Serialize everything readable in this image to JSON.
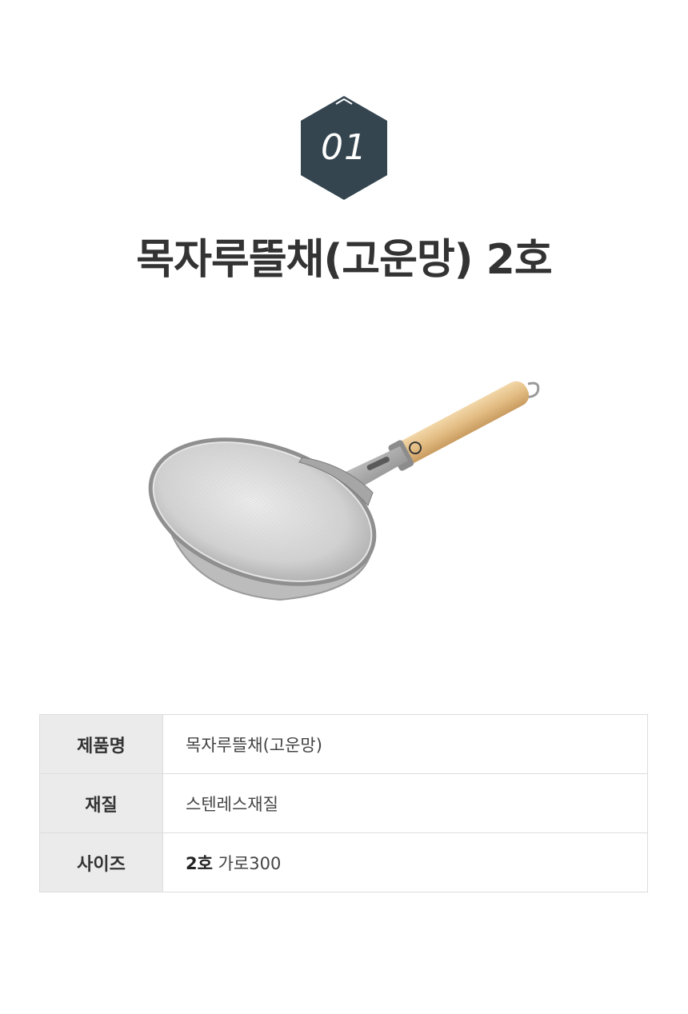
{
  "badge": {
    "number": "01",
    "color": "#344550"
  },
  "product": {
    "title": "목자루뜰채(고운망) 2호",
    "image_icon": "mesh-strainer-with-wooden-handle"
  },
  "specs": [
    {
      "label": "제품명",
      "value_strong": "",
      "value": "목자루뜰채(고운망)"
    },
    {
      "label": "재질",
      "value_strong": "",
      "value": "스텐레스재질"
    },
    {
      "label": "사이즈",
      "value_strong": "2호",
      "value": " 가로300"
    }
  ]
}
